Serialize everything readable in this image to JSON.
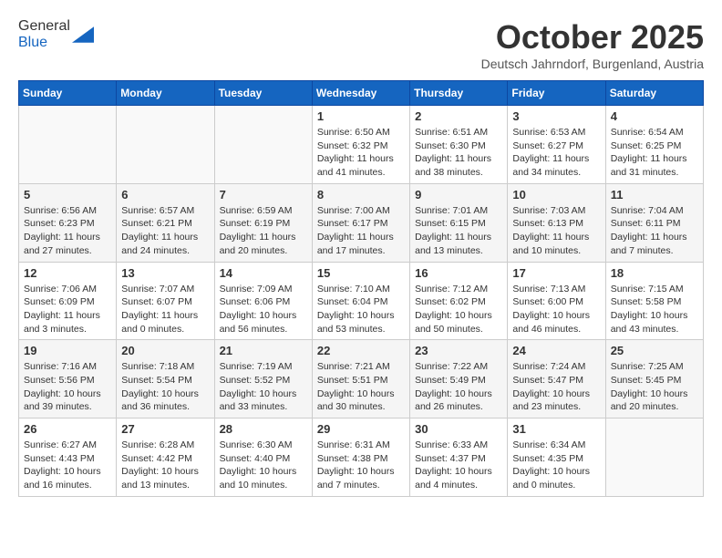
{
  "header": {
    "logo_general": "General",
    "logo_blue": "Blue",
    "month_title": "October 2025",
    "subtitle": "Deutsch Jahrndorf, Burgenland, Austria"
  },
  "weekdays": [
    "Sunday",
    "Monday",
    "Tuesday",
    "Wednesday",
    "Thursday",
    "Friday",
    "Saturday"
  ],
  "weeks": [
    [
      {
        "day": "",
        "sunrise": "",
        "sunset": "",
        "daylight": ""
      },
      {
        "day": "",
        "sunrise": "",
        "sunset": "",
        "daylight": ""
      },
      {
        "day": "",
        "sunrise": "",
        "sunset": "",
        "daylight": ""
      },
      {
        "day": "1",
        "sunrise": "Sunrise: 6:50 AM",
        "sunset": "Sunset: 6:32 PM",
        "daylight": "Daylight: 11 hours and 41 minutes."
      },
      {
        "day": "2",
        "sunrise": "Sunrise: 6:51 AM",
        "sunset": "Sunset: 6:30 PM",
        "daylight": "Daylight: 11 hours and 38 minutes."
      },
      {
        "day": "3",
        "sunrise": "Sunrise: 6:53 AM",
        "sunset": "Sunset: 6:27 PM",
        "daylight": "Daylight: 11 hours and 34 minutes."
      },
      {
        "day": "4",
        "sunrise": "Sunrise: 6:54 AM",
        "sunset": "Sunset: 6:25 PM",
        "daylight": "Daylight: 11 hours and 31 minutes."
      }
    ],
    [
      {
        "day": "5",
        "sunrise": "Sunrise: 6:56 AM",
        "sunset": "Sunset: 6:23 PM",
        "daylight": "Daylight: 11 hours and 27 minutes."
      },
      {
        "day": "6",
        "sunrise": "Sunrise: 6:57 AM",
        "sunset": "Sunset: 6:21 PM",
        "daylight": "Daylight: 11 hours and 24 minutes."
      },
      {
        "day": "7",
        "sunrise": "Sunrise: 6:59 AM",
        "sunset": "Sunset: 6:19 PM",
        "daylight": "Daylight: 11 hours and 20 minutes."
      },
      {
        "day": "8",
        "sunrise": "Sunrise: 7:00 AM",
        "sunset": "Sunset: 6:17 PM",
        "daylight": "Daylight: 11 hours and 17 minutes."
      },
      {
        "day": "9",
        "sunrise": "Sunrise: 7:01 AM",
        "sunset": "Sunset: 6:15 PM",
        "daylight": "Daylight: 11 hours and 13 minutes."
      },
      {
        "day": "10",
        "sunrise": "Sunrise: 7:03 AM",
        "sunset": "Sunset: 6:13 PM",
        "daylight": "Daylight: 11 hours and 10 minutes."
      },
      {
        "day": "11",
        "sunrise": "Sunrise: 7:04 AM",
        "sunset": "Sunset: 6:11 PM",
        "daylight": "Daylight: 11 hours and 7 minutes."
      }
    ],
    [
      {
        "day": "12",
        "sunrise": "Sunrise: 7:06 AM",
        "sunset": "Sunset: 6:09 PM",
        "daylight": "Daylight: 11 hours and 3 minutes."
      },
      {
        "day": "13",
        "sunrise": "Sunrise: 7:07 AM",
        "sunset": "Sunset: 6:07 PM",
        "daylight": "Daylight: 11 hours and 0 minutes."
      },
      {
        "day": "14",
        "sunrise": "Sunrise: 7:09 AM",
        "sunset": "Sunset: 6:06 PM",
        "daylight": "Daylight: 10 hours and 56 minutes."
      },
      {
        "day": "15",
        "sunrise": "Sunrise: 7:10 AM",
        "sunset": "Sunset: 6:04 PM",
        "daylight": "Daylight: 10 hours and 53 minutes."
      },
      {
        "day": "16",
        "sunrise": "Sunrise: 7:12 AM",
        "sunset": "Sunset: 6:02 PM",
        "daylight": "Daylight: 10 hours and 50 minutes."
      },
      {
        "day": "17",
        "sunrise": "Sunrise: 7:13 AM",
        "sunset": "Sunset: 6:00 PM",
        "daylight": "Daylight: 10 hours and 46 minutes."
      },
      {
        "day": "18",
        "sunrise": "Sunrise: 7:15 AM",
        "sunset": "Sunset: 5:58 PM",
        "daylight": "Daylight: 10 hours and 43 minutes."
      }
    ],
    [
      {
        "day": "19",
        "sunrise": "Sunrise: 7:16 AM",
        "sunset": "Sunset: 5:56 PM",
        "daylight": "Daylight: 10 hours and 39 minutes."
      },
      {
        "day": "20",
        "sunrise": "Sunrise: 7:18 AM",
        "sunset": "Sunset: 5:54 PM",
        "daylight": "Daylight: 10 hours and 36 minutes."
      },
      {
        "day": "21",
        "sunrise": "Sunrise: 7:19 AM",
        "sunset": "Sunset: 5:52 PM",
        "daylight": "Daylight: 10 hours and 33 minutes."
      },
      {
        "day": "22",
        "sunrise": "Sunrise: 7:21 AM",
        "sunset": "Sunset: 5:51 PM",
        "daylight": "Daylight: 10 hours and 30 minutes."
      },
      {
        "day": "23",
        "sunrise": "Sunrise: 7:22 AM",
        "sunset": "Sunset: 5:49 PM",
        "daylight": "Daylight: 10 hours and 26 minutes."
      },
      {
        "day": "24",
        "sunrise": "Sunrise: 7:24 AM",
        "sunset": "Sunset: 5:47 PM",
        "daylight": "Daylight: 10 hours and 23 minutes."
      },
      {
        "day": "25",
        "sunrise": "Sunrise: 7:25 AM",
        "sunset": "Sunset: 5:45 PM",
        "daylight": "Daylight: 10 hours and 20 minutes."
      }
    ],
    [
      {
        "day": "26",
        "sunrise": "Sunrise: 6:27 AM",
        "sunset": "Sunset: 4:43 PM",
        "daylight": "Daylight: 10 hours and 16 minutes."
      },
      {
        "day": "27",
        "sunrise": "Sunrise: 6:28 AM",
        "sunset": "Sunset: 4:42 PM",
        "daylight": "Daylight: 10 hours and 13 minutes."
      },
      {
        "day": "28",
        "sunrise": "Sunrise: 6:30 AM",
        "sunset": "Sunset: 4:40 PM",
        "daylight": "Daylight: 10 hours and 10 minutes."
      },
      {
        "day": "29",
        "sunrise": "Sunrise: 6:31 AM",
        "sunset": "Sunset: 4:38 PM",
        "daylight": "Daylight: 10 hours and 7 minutes."
      },
      {
        "day": "30",
        "sunrise": "Sunrise: 6:33 AM",
        "sunset": "Sunset: 4:37 PM",
        "daylight": "Daylight: 10 hours and 4 minutes."
      },
      {
        "day": "31",
        "sunrise": "Sunrise: 6:34 AM",
        "sunset": "Sunset: 4:35 PM",
        "daylight": "Daylight: 10 hours and 0 minutes."
      },
      {
        "day": "",
        "sunrise": "",
        "sunset": "",
        "daylight": ""
      }
    ]
  ]
}
